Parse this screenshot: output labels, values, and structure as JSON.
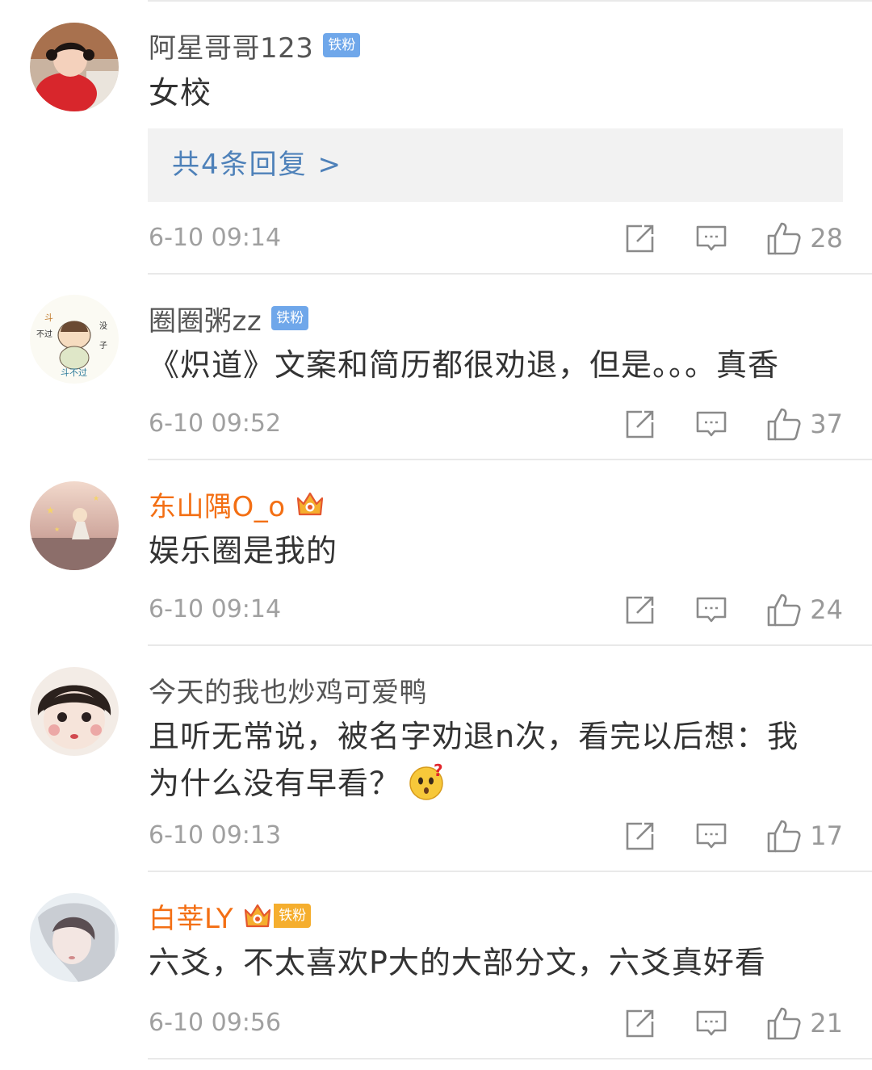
{
  "colors": {
    "vip_name": "#f36f14",
    "normal_name": "#555555",
    "link": "#4e81b9",
    "badge_blue": "#6fa7ea",
    "badge_gold": "#f5ae2e"
  },
  "comments": [
    {
      "name": "阿星哥哥123",
      "badge": "铁粉",
      "text": "女校",
      "replies": "共4条回复 >",
      "time": "6-10 09:14",
      "likes": "28"
    },
    {
      "name": "圈圈粥zz",
      "badge": "铁粉",
      "text": "《炽道》文案和简历都很劝退，但是。。。真香",
      "time": "6-10 09:52",
      "likes": "37"
    },
    {
      "name": "东山隅O_o",
      "crown_level": "4",
      "text": "娱乐圈是我的",
      "time": "6-10 09:14",
      "likes": "24"
    },
    {
      "name": "今天的我也炒鸡可爱鸭",
      "text_line1": "且听无常说，被名字劝退n次，看完以后想：我",
      "text_line2": "为什么没有早看？",
      "emoji": "question-face-emoji",
      "time": "6-10 09:13",
      "likes": "17"
    },
    {
      "name": "白莘LY",
      "crown_level": "5",
      "badge": "铁粉",
      "text": "六爻，不太喜欢P大的大部分文，六爻真好看",
      "time": "6-10 09:56",
      "likes": "21"
    }
  ],
  "icons": {
    "share": "share-icon",
    "reply": "comment-icon",
    "like": "thumbs-up-icon",
    "crown": "crown-icon"
  }
}
